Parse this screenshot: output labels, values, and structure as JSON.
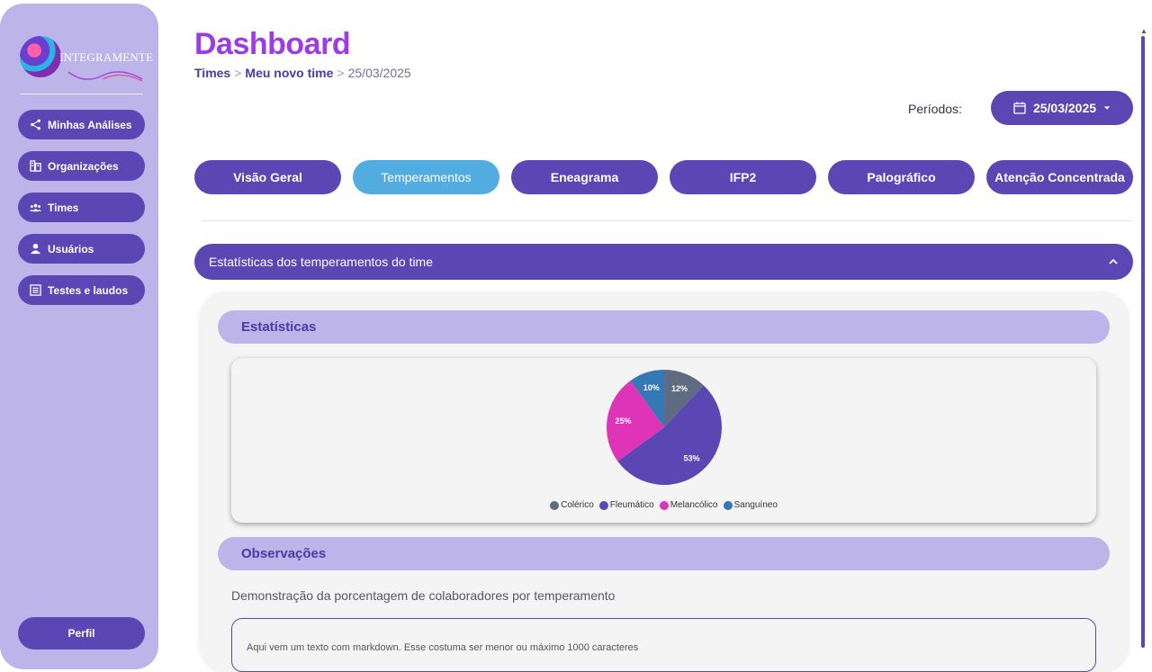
{
  "sidebar": {
    "logo_text": "INTEGRAMENTE",
    "items": [
      {
        "label": "Minhas Análises",
        "icon": "share-icon"
      },
      {
        "label": "Organizações",
        "icon": "building-icon"
      },
      {
        "label": "Times",
        "icon": "group-icon"
      },
      {
        "label": "Usuários",
        "icon": "person-icon"
      },
      {
        "label": "Testes e laudos",
        "icon": "list-icon"
      }
    ],
    "profile_label": "Perfil"
  },
  "header": {
    "title": "Dashboard",
    "breadcrumb": [
      "Times",
      "Meu novo time",
      "25/03/2025"
    ],
    "periods_label": "Períodos:",
    "date_value": "25/03/2025"
  },
  "tabs": [
    {
      "label": "Visão Geral",
      "active": false
    },
    {
      "label": "Temperamentos",
      "active": true
    },
    {
      "label": "Eneagrama",
      "active": false
    },
    {
      "label": "IFP2",
      "active": false
    },
    {
      "label": "Palográfico",
      "active": false
    },
    {
      "label": "Atenção Concentrada",
      "active": false
    }
  ],
  "accordion": {
    "title": "Estatísticas dos temperamentos do time"
  },
  "sections": {
    "stats_title": "Estatísticas",
    "obs_title": "Observações"
  },
  "description": "Demonstração da porcentagem de colaboradores por temperamento",
  "markdown_preview": "Aqui vem um texto com markdown. Esse costuma ser menor ou máximo 1000 caracteres",
  "colors": {
    "primary": "#5a47b4",
    "active_tab": "#52ace0",
    "sidebar": "#bdb4ea",
    "title": "#9c3ce6"
  },
  "chart_data": {
    "type": "pie",
    "categories": [
      "Colérico",
      "Fleumático",
      "Melancólico",
      "Sanguíneo"
    ],
    "values": [
      12,
      53,
      25,
      10
    ],
    "colors": [
      "#5f6b80",
      "#5a47b4",
      "#e034b8",
      "#3478b5"
    ],
    "labels": [
      "12%",
      "53%",
      "25%",
      "10%"
    ],
    "legend_position": "bottom"
  }
}
